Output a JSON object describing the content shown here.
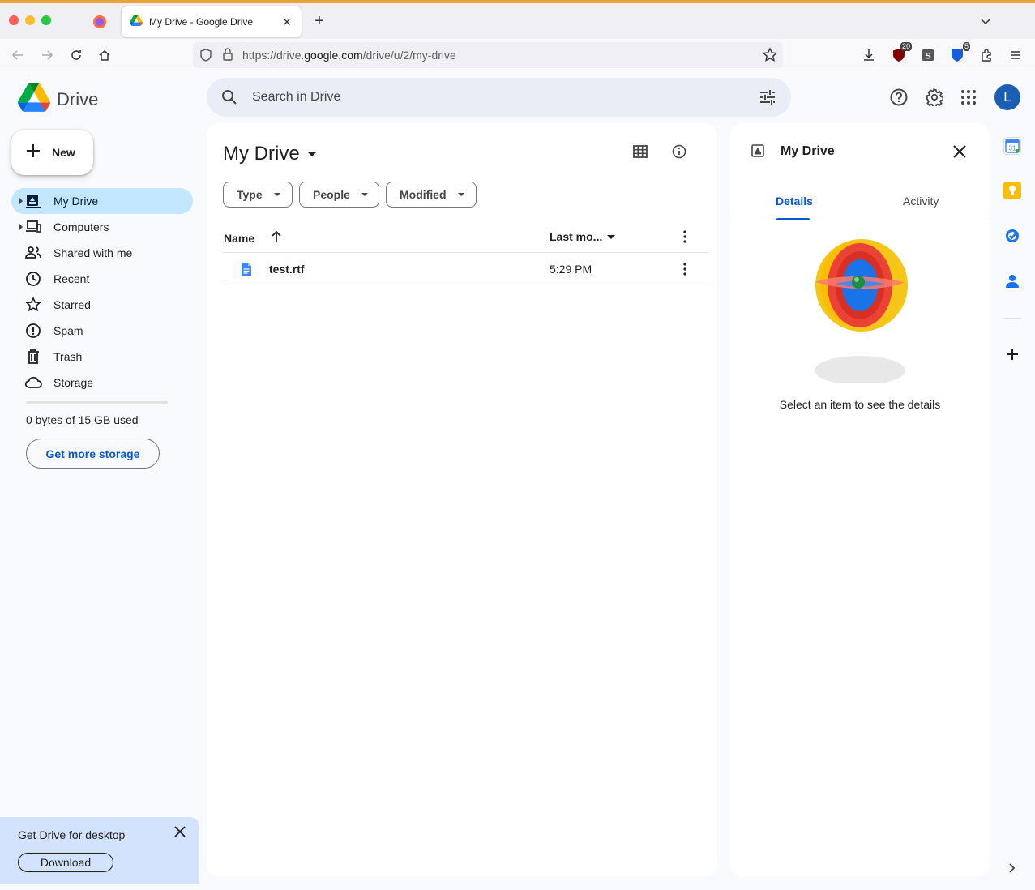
{
  "browser": {
    "tab_title": "My Drive - Google Drive",
    "url_prefix": "https://drive.",
    "url_domain": "google.com",
    "url_path": "/drive/u/2/my-drive",
    "ext_badges": [
      "20",
      "5"
    ]
  },
  "header": {
    "app_name": "Drive",
    "search_placeholder": "Search in Drive",
    "avatar_letter": "L"
  },
  "sidebar": {
    "new_label": "New",
    "items": [
      {
        "label": "My Drive",
        "icon": "my-drive-icon",
        "active": true
      },
      {
        "label": "Computers",
        "icon": "computers-icon"
      },
      {
        "label": "Shared with me",
        "icon": "shared-icon"
      },
      {
        "label": "Recent",
        "icon": "clock-icon"
      },
      {
        "label": "Starred",
        "icon": "star-icon"
      },
      {
        "label": "Spam",
        "icon": "spam-icon"
      },
      {
        "label": "Trash",
        "icon": "trash-icon"
      },
      {
        "label": "Storage",
        "icon": "cloud-icon"
      }
    ],
    "storage_used": "0 bytes of 15 GB used",
    "storage_button": "Get more storage"
  },
  "promo": {
    "title": "Get Drive for desktop",
    "button": "Download"
  },
  "main": {
    "title": "My Drive",
    "filters": [
      "Type",
      "People",
      "Modified"
    ],
    "columns": {
      "name": "Name",
      "modified": "Last mo..."
    },
    "files": [
      {
        "name": "test.rtf",
        "modified": "5:29 PM",
        "type": "doc"
      }
    ]
  },
  "details": {
    "title": "My Drive",
    "tabs": [
      "Details",
      "Activity"
    ],
    "active_tab": "Details",
    "message": "Select an item to see the details"
  },
  "colors": {
    "accent": "#0b57d0",
    "active_nav": "#c2e7ff",
    "search_bg": "#e9eef6",
    "promo_bg": "#d3e3fd"
  }
}
